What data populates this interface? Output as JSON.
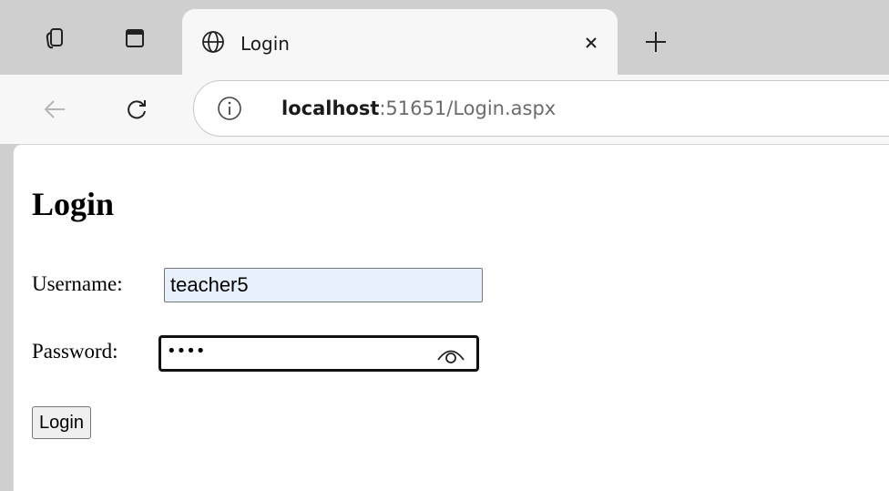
{
  "browser": {
    "tab": {
      "title": "Login"
    },
    "address": {
      "host": "localhost",
      "path": ":51651/Login.aspx"
    },
    "icons": {
      "workspaces": "workspaces-icon",
      "tab_actions": "tab-actions-icon",
      "site": "globe-icon",
      "close_tab": "close-icon",
      "new_tab": "plus-icon",
      "back": "back-arrow-icon",
      "refresh": "refresh-icon",
      "site_info": "info-icon"
    }
  },
  "page": {
    "title": "Login",
    "username": {
      "label": "Username:",
      "value": "teacher5"
    },
    "password": {
      "label": "Password:",
      "masked_value": "••••"
    },
    "login_button": "Login"
  },
  "colors": {
    "chrome_bg": "#cfcfcf",
    "toolbar_bg": "#f7f7f7",
    "autofill_bg": "#e8f0fe"
  }
}
